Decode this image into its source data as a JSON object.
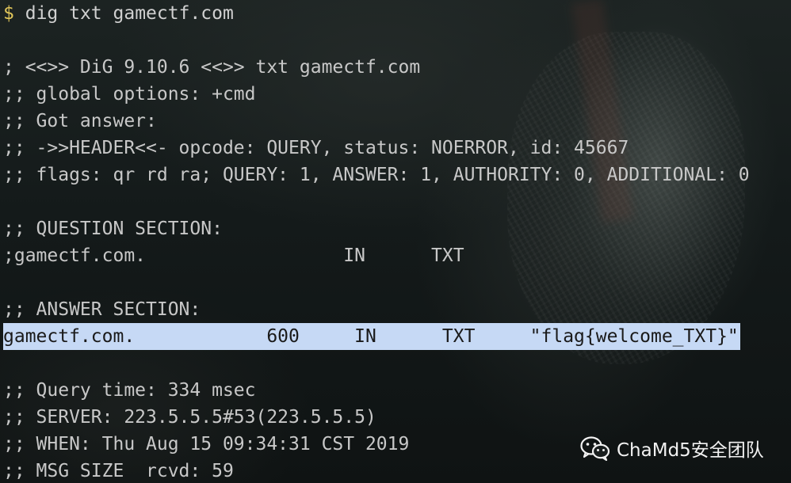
{
  "terminal": {
    "prompt_symbol": "$",
    "command": "dig txt gamectf.com",
    "lines": [
      "",
      "; <<>> DiG 9.10.6 <<>> txt gamectf.com",
      ";; global options: +cmd",
      ";; Got answer:",
      ";; ->>HEADER<<- opcode: QUERY, status: NOERROR, id: 45667",
      ";; flags: qr rd ra; QUERY: 1, ANSWER: 1, AUTHORITY: 0, ADDITIONAL: 0",
      "",
      ";; QUESTION SECTION:",
      ";gamectf.com.                  IN      TXT",
      "",
      ";; ANSWER SECTION:"
    ],
    "answer_record": "gamectf.com.            600     IN      TXT     \"flag{welcome_TXT}\"",
    "trailer_lines": [
      "",
      ";; Query time: 334 msec",
      ";; SERVER: 223.5.5.5#53(223.5.5.5)",
      ";; WHEN: Thu Aug 15 09:34:31 CST 2019",
      ";; MSG SIZE  rcvd: 59"
    ]
  },
  "watermark": {
    "icon": "wechat-icon",
    "text": "ChaMd5安全团队"
  },
  "colors": {
    "prompt": "#e0c55a",
    "text": "#c8c8c8",
    "selection": "#c6d9f5"
  }
}
